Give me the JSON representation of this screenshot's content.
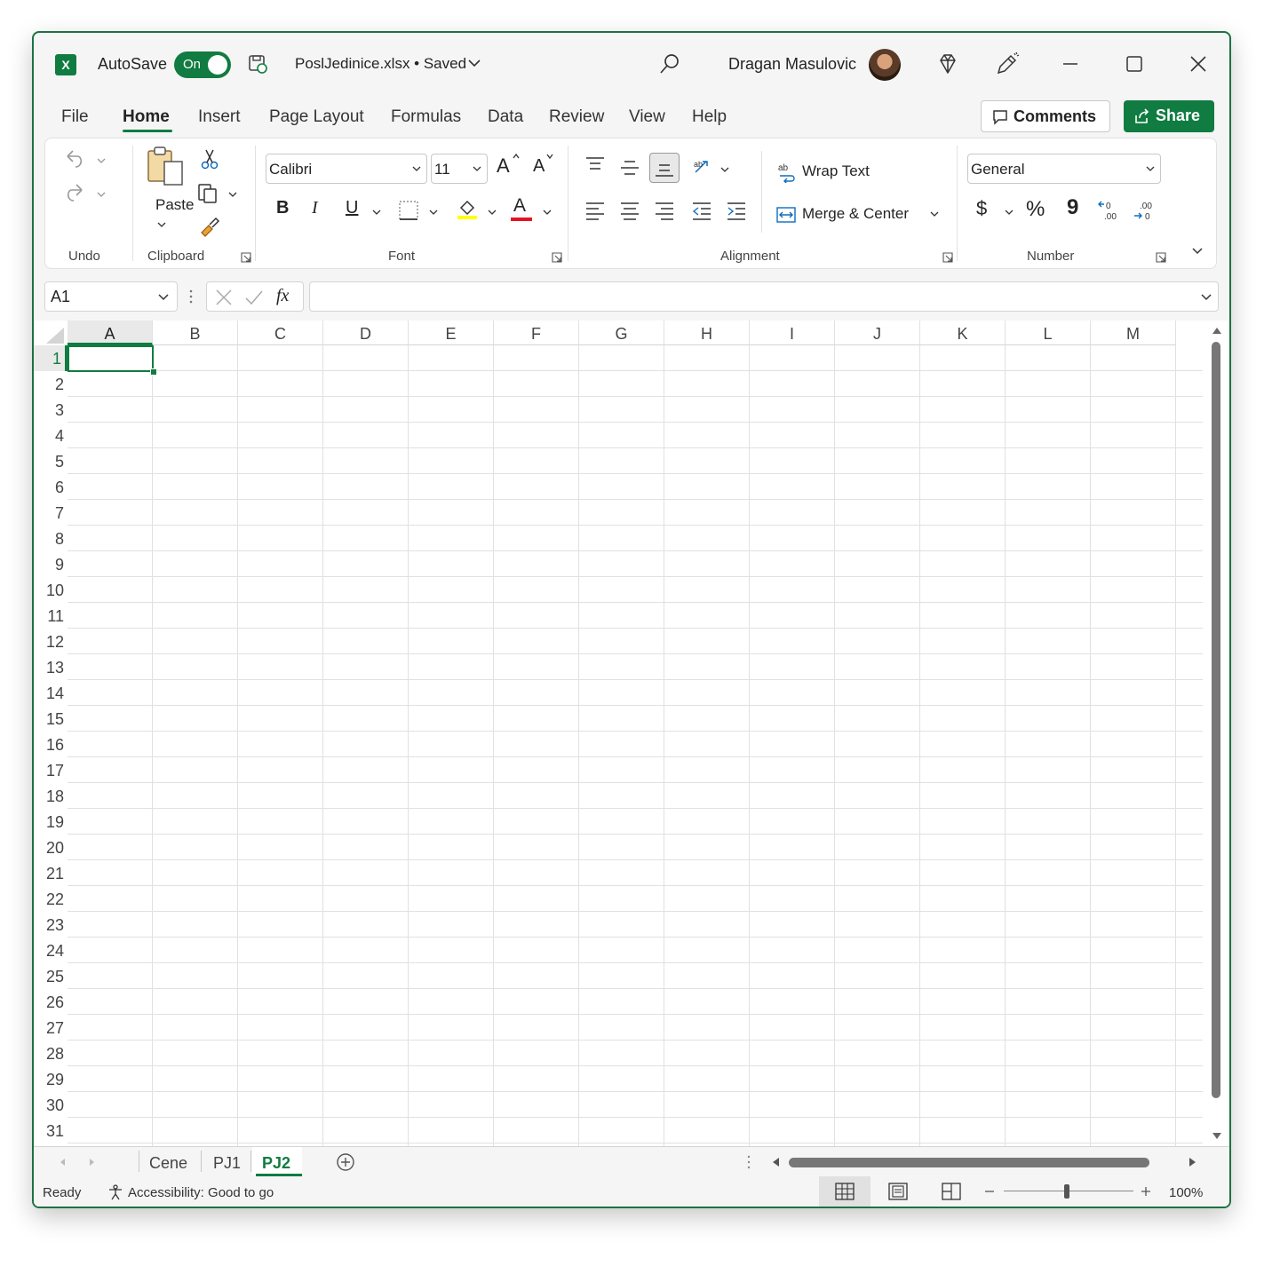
{
  "titlebar": {
    "app_badge": "X",
    "autosave_label": "AutoSave",
    "autosave_state": "On",
    "filename": "PoslJedinice.xlsx • Saved",
    "user_name": "Dragan Masulovic"
  },
  "menu": {
    "tabs": [
      "File",
      "Home",
      "Insert",
      "Page Layout",
      "Formulas",
      "Data",
      "Review",
      "View",
      "Help"
    ],
    "active_tab": "Home",
    "comments_label": "Comments",
    "share_label": "Share"
  },
  "ribbon": {
    "groups": {
      "undo": "Undo",
      "clipboard": "Clipboard",
      "font": "Font",
      "alignment": "Alignment",
      "number": "Number"
    },
    "paste_label": "Paste",
    "font_name": "Calibri",
    "font_size": "11",
    "bold": "B",
    "italic": "I",
    "underline": "U",
    "font_color_glyph": "A",
    "wrap_text_label": "Wrap Text",
    "merge_label": "Merge & Center",
    "number_format": "General",
    "currency_glyph": "$",
    "percent_glyph": "%",
    "comma_glyph": "9",
    "increase_font_glyph": "A",
    "decrease_font_glyph": "A",
    "fill_color": "#ffff00",
    "font_color": "#e81123"
  },
  "formula_bar": {
    "name_box": "A1",
    "fx": "fx",
    "value": ""
  },
  "grid": {
    "columns": [
      "A",
      "B",
      "C",
      "D",
      "E",
      "F",
      "G",
      "H",
      "I",
      "J",
      "K",
      "L",
      "M"
    ],
    "rows": [
      "1",
      "2",
      "3",
      "4",
      "5",
      "6",
      "7",
      "8",
      "9",
      "10",
      "11",
      "12",
      "13",
      "14",
      "15",
      "16",
      "17",
      "18",
      "19",
      "20",
      "21",
      "22",
      "23",
      "24",
      "25",
      "26",
      "27",
      "28",
      "29",
      "30",
      "31"
    ],
    "selected_cell": "A1"
  },
  "sheets": {
    "tabs": [
      "Cene",
      "PJ1",
      "PJ2"
    ],
    "active": "PJ2"
  },
  "status": {
    "ready": "Ready",
    "accessibility": "Accessibility: Good to go",
    "zoom": "100%"
  },
  "colors": {
    "accent": "#107c41"
  }
}
